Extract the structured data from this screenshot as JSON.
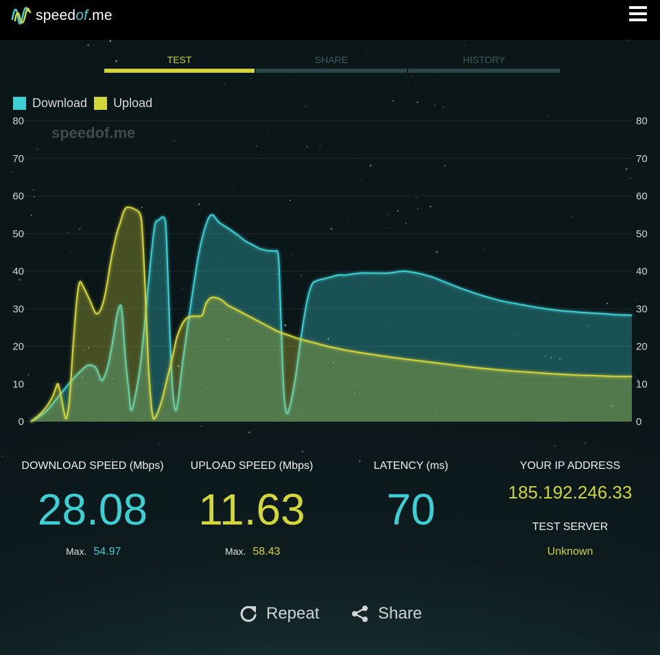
{
  "brand": {
    "name_prefix": "speed",
    "name_italic": "of",
    "name_suffix": ".me"
  },
  "tabs": [
    {
      "label": "TEST",
      "active": true
    },
    {
      "label": "SHARE",
      "active": false
    },
    {
      "label": "HISTORY",
      "active": false
    }
  ],
  "legend": {
    "download": "Download",
    "upload": "Upload"
  },
  "colors": {
    "download": "#3ccfd4",
    "upload": "#d3d63a",
    "accent_tab": "#d2d63c",
    "ip_text": "#cfd23a"
  },
  "chart_watermark": "speedof.me",
  "chart_data": {
    "type": "area",
    "ylim": [
      0,
      80
    ],
    "yticks": [
      0,
      10,
      20,
      30,
      40,
      50,
      60,
      70,
      80
    ],
    "grid": true,
    "legend_position": "top-left",
    "series": [
      {
        "name": "Download",
        "points": [
          [
            0,
            0
          ],
          [
            2,
            2.5
          ],
          [
            4,
            7
          ],
          [
            5.5,
            10.5
          ],
          [
            7,
            13.5
          ],
          [
            8,
            15
          ],
          [
            9,
            14.5
          ],
          [
            9.5,
            12.5
          ],
          [
            10,
            11
          ],
          [
            10.8,
            15
          ],
          [
            11.5,
            22
          ],
          [
            12,
            28
          ],
          [
            12.5,
            31
          ],
          [
            12.8,
            28
          ],
          [
            13.2,
            17
          ],
          [
            13.7,
            8
          ],
          [
            14,
            3
          ],
          [
            14.5,
            6
          ],
          [
            15.3,
            15
          ],
          [
            16,
            28
          ],
          [
            16.7,
            42
          ],
          [
            17.3,
            52
          ],
          [
            17.8,
            53.5
          ],
          [
            18.7,
            54
          ],
          [
            19,
            47
          ],
          [
            19.4,
            25
          ],
          [
            19.8,
            9
          ],
          [
            20.2,
            3
          ],
          [
            20.6,
            6
          ],
          [
            21.3,
            17
          ],
          [
            22.5,
            33
          ],
          [
            23.5,
            45
          ],
          [
            24.5,
            52.5
          ],
          [
            25.3,
            55
          ],
          [
            26.3,
            53
          ],
          [
            27.5,
            51.5
          ],
          [
            29,
            49.5
          ],
          [
            30,
            48
          ],
          [
            31,
            47
          ],
          [
            32,
            46
          ],
          [
            33,
            45.5
          ],
          [
            34,
            45.3
          ],
          [
            34.6,
            44
          ],
          [
            34.9,
            30
          ],
          [
            35.3,
            10
          ],
          [
            35.7,
            2.5
          ],
          [
            36.2,
            4
          ],
          [
            37,
            12
          ],
          [
            37.8,
            23
          ],
          [
            38.6,
            32
          ],
          [
            39.3,
            36.5
          ],
          [
            40,
            37.5
          ],
          [
            41,
            38
          ],
          [
            42,
            38.5
          ],
          [
            43,
            39
          ],
          [
            44,
            39
          ],
          [
            46,
            39.5
          ],
          [
            48,
            39.5
          ],
          [
            50,
            39.5
          ],
          [
            52,
            40
          ],
          [
            54,
            39.5
          ],
          [
            56,
            38.5
          ],
          [
            58,
            37
          ],
          [
            60,
            35.5
          ],
          [
            62,
            34.2
          ],
          [
            64,
            33
          ],
          [
            66,
            32
          ],
          [
            68,
            31.3
          ],
          [
            70,
            30.6
          ],
          [
            72,
            30
          ],
          [
            74,
            29.5
          ],
          [
            76,
            29.2
          ],
          [
            78,
            28.9
          ],
          [
            80,
            28.7
          ],
          [
            82,
            28.4
          ],
          [
            84,
            28.3
          ]
        ]
      },
      {
        "name": "Upload",
        "points": [
          [
            0,
            0
          ],
          [
            1,
            1.5
          ],
          [
            2,
            3.5
          ],
          [
            3,
            6.5
          ],
          [
            3.5,
            9
          ],
          [
            3.8,
            10
          ],
          [
            4.2,
            7
          ],
          [
            4.7,
            2
          ],
          [
            5,
            1
          ],
          [
            5.4,
            6
          ],
          [
            5.9,
            20
          ],
          [
            6.4,
            32
          ],
          [
            6.8,
            37
          ],
          [
            7.3,
            36
          ],
          [
            8.3,
            32
          ],
          [
            9,
            29
          ],
          [
            9.5,
            29
          ],
          [
            10,
            31
          ],
          [
            10.5,
            35
          ],
          [
            11.3,
            44
          ],
          [
            12,
            50
          ],
          [
            12.5,
            53
          ],
          [
            13,
            56
          ],
          [
            13.5,
            57
          ],
          [
            14.5,
            56.5
          ],
          [
            15.3,
            55
          ],
          [
            15.6,
            50
          ],
          [
            16,
            34
          ],
          [
            16.4,
            16
          ],
          [
            16.8,
            5
          ],
          [
            17.1,
            1
          ],
          [
            17.5,
            1.5
          ],
          [
            18.2,
            5
          ],
          [
            19,
            11
          ],
          [
            20,
            19
          ],
          [
            20.5,
            23
          ],
          [
            21.5,
            27
          ],
          [
            22.5,
            28
          ],
          [
            23.5,
            28
          ],
          [
            24,
            28.5
          ],
          [
            24.5,
            31.5
          ],
          [
            25.3,
            33
          ],
          [
            26.5,
            32.5
          ],
          [
            27.5,
            31
          ],
          [
            28.5,
            30
          ],
          [
            30,
            28.5
          ],
          [
            31.5,
            27
          ],
          [
            33,
            25.5
          ],
          [
            34.5,
            24
          ],
          [
            36,
            23
          ],
          [
            37.5,
            22
          ],
          [
            39.5,
            21
          ],
          [
            41.5,
            20
          ],
          [
            44,
            19
          ],
          [
            46.5,
            18.2
          ],
          [
            49,
            17.5
          ],
          [
            52,
            16.7
          ],
          [
            55,
            16
          ],
          [
            58,
            15.3
          ],
          [
            61,
            14.6
          ],
          [
            64,
            14
          ],
          [
            67,
            13.5
          ],
          [
            70,
            13.1
          ],
          [
            73,
            12.7
          ],
          [
            76,
            12.4
          ],
          [
            79,
            12.2
          ],
          [
            82,
            12
          ],
          [
            84,
            12
          ]
        ]
      }
    ]
  },
  "stats": {
    "download": {
      "title": "DOWNLOAD SPEED (Mbps)",
      "value": "28.08",
      "max_label": "Max.",
      "max_value": "54.97"
    },
    "upload": {
      "title": "UPLOAD SPEED (Mbps)",
      "value": "11.63",
      "max_label": "Max.",
      "max_value": "58.43"
    },
    "latency": {
      "title": "LATENCY (ms)",
      "value": "70"
    },
    "ip": {
      "title": "YOUR IP ADDRESS",
      "value": "185.192.246.33"
    },
    "server": {
      "title": "TEST SERVER",
      "value": "Unknown"
    }
  },
  "actions": {
    "repeat": "Repeat",
    "share": "Share"
  },
  "icons": {
    "menu": "hamburger-menu-icon",
    "repeat": "repeat-icon",
    "share": "share-icon",
    "logo": "speedofme-wave-logo-icon"
  }
}
